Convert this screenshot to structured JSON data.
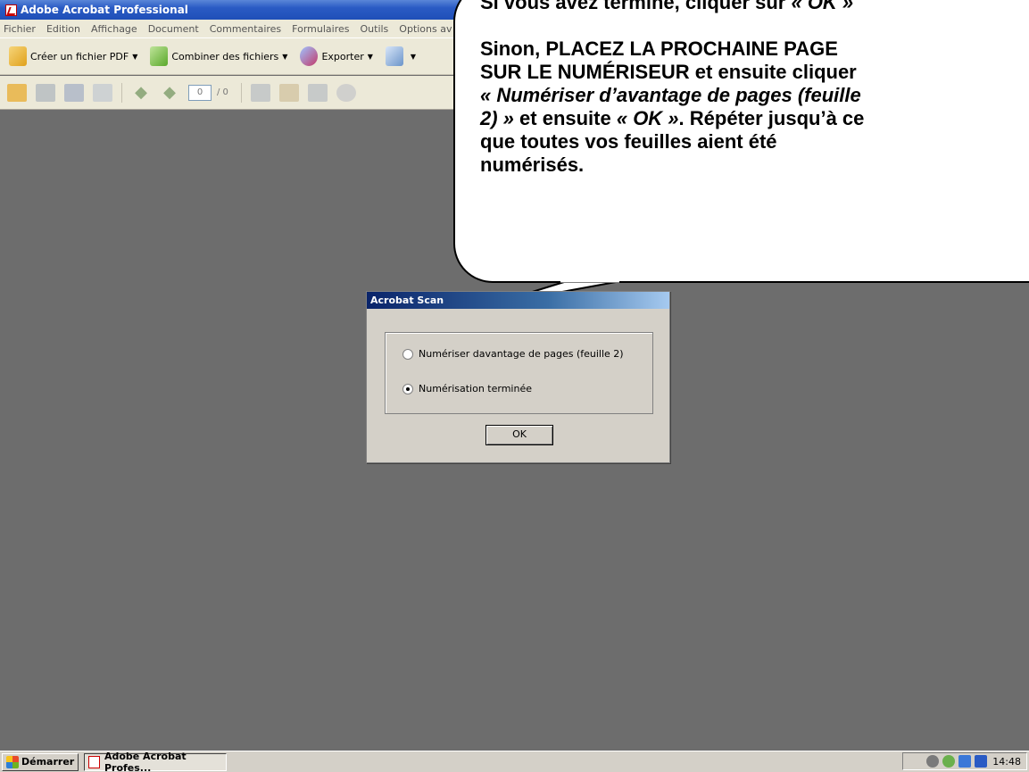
{
  "window": {
    "title": "Adobe Acrobat Professional"
  },
  "menubar": {
    "items": [
      "Fichier",
      "Edition",
      "Affichage",
      "Document",
      "Commentaires",
      "Formulaires",
      "Outils",
      "Options av"
    ]
  },
  "toolbar": {
    "create_pdf": "Créer un fichier PDF",
    "combine": "Combiner des fichiers",
    "export": "Exporter",
    "page_current": "0",
    "page_total": "/ 0"
  },
  "callout": {
    "line1_prefix": "Si vous avez terminé, cliquer sur ",
    "line1_italic": "« OK »",
    "para2_a": "Sinon,  PLACEZ LA PROCHAINE PAGE",
    "para2_b": "SUR LE NUMÉRISEUR et ensuite cliquer",
    "para2_c": "« Numériser d’avantage de pages (feuille",
    "para2_d_italic": "2) »",
    "para2_d_rest": " et ensuite ",
    "para2_d_ok": "« OK »",
    "para2_d_end": ". Répéter jusqu’à ce",
    "para2_e": "que toutes vos feuilles aient été",
    "para2_f": "numérisés."
  },
  "dialog": {
    "title": "Acrobat Scan",
    "option_more": "Numériser davantage de pages (feuille 2)",
    "option_done": "Numérisation terminée",
    "selected": "option_done",
    "ok_label": "OK"
  },
  "taskbar": {
    "start": "Démarrer",
    "task": "Adobe Acrobat Profes...",
    "clock": "14:48"
  }
}
